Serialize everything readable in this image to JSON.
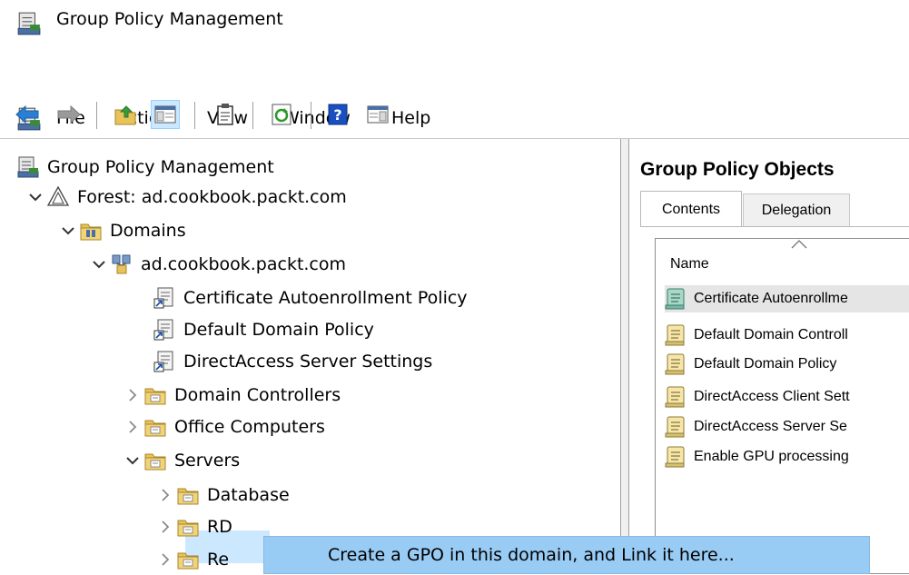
{
  "window": {
    "title": "Group Policy Management",
    "icon": "gpmc-app-icon"
  },
  "menu": [
    "File",
    "Action",
    "View",
    "Window",
    "Help"
  ],
  "toolbar": [
    "back-arrow-icon",
    "forward-arrow-icon",
    "up-folder-icon",
    "show-hide-tree-icon",
    "properties-icon",
    "refresh-icon",
    "help-icon",
    "action-pane-icon"
  ],
  "tree": {
    "root": "Group Policy Management",
    "forest": "Forest: ad.cookbook.packt.com",
    "domains": "Domains",
    "domain": "ad.cookbook.packt.com",
    "gpo_links": [
      "Certificate Autoenrollment Policy",
      "Default Domain Policy",
      "DirectAccess Server Settings"
    ],
    "ous": [
      "Domain Controllers",
      "Office Computers",
      "Servers"
    ],
    "server_children": [
      "Database",
      "RD",
      "Re"
    ]
  },
  "right": {
    "title": "Group Policy Objects",
    "tabs": [
      "Contents",
      "Delegation"
    ],
    "column": "Name",
    "items": [
      "Certificate Autoenrollme",
      "Default Domain Controll",
      "Default Domain Policy",
      "DirectAccess Client Sett",
      "DirectAccess Server Se",
      "Enable GPU processing"
    ]
  },
  "context_menu": {
    "item": "Create a GPO in this domain, and Link it here..."
  },
  "colors": {
    "selection": "#cce8ff",
    "menu_highlight": "#99ccf5",
    "list_selected": "#e5e5e5"
  }
}
